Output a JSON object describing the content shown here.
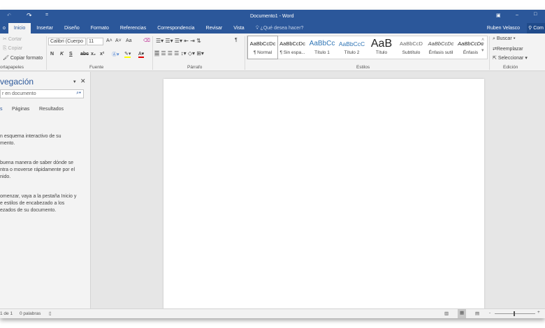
{
  "title": "Documento1 - Word",
  "quick_access": {
    "undo": "↶",
    "redo": "↷",
    "customize": "="
  },
  "window_controls": {
    "ribbon_options": "▣",
    "minimize": "–",
    "maximize": "□"
  },
  "tabs": [
    "Inicio",
    "Insertar",
    "Diseño",
    "Formato",
    "Referencias",
    "Correspondencia",
    "Revisar",
    "Vista"
  ],
  "tell_me": "¿Qué desea hacer?",
  "user": "Ruben Velasco",
  "share": "Com",
  "clipboard": {
    "cut": "Cortar",
    "copy": "Copiar",
    "format_painter": "Copiar formato",
    "label": "ortapapeles"
  },
  "font": {
    "name": "Calibri (Cuerpo",
    "size": "11",
    "label": "Fuente",
    "bold": "N",
    "italic": "K",
    "underline": "S",
    "strike": "abc",
    "sub": "x₂",
    "sup": "x²",
    "grow": "A˄",
    "shrink": "A˅",
    "case": "Aa"
  },
  "paragraph": {
    "label": "Párrafo",
    "show_marks": "¶"
  },
  "styles": {
    "label": "Estilos",
    "items": [
      {
        "preview": "AaBbCcDc",
        "name": "¶ Normal"
      },
      {
        "preview": "AaBbCcDc",
        "name": "¶ Sin espa..."
      },
      {
        "preview": "AaBbCc",
        "name": "Título 1"
      },
      {
        "preview": "AaBbCcC",
        "name": "Título 2"
      },
      {
        "preview": "AaB",
        "name": "Título"
      },
      {
        "preview": "AaBbCcD",
        "name": "Subtítulo"
      },
      {
        "preview": "AaBbCcDc",
        "name": "Énfasis sutil"
      },
      {
        "preview": "AaBbCcDc",
        "name": "Énfasis"
      }
    ]
  },
  "editing": {
    "find": "Buscar",
    "replace": "Reemplazar",
    "select": "Seleccionar",
    "label": "Edición"
  },
  "navigation": {
    "title": "vegación",
    "search_placeholder": "r en documento",
    "tabs": [
      "s",
      "Páginas",
      "Resultados"
    ],
    "paragraphs": [
      "n esquema interactivo de su\nmento.",
      "buena manera de saber dónde se\nntra o moverse rápidamente por el\nnido.",
      "omenzar, vaya a la pestaña Inicio y\ne estilos de encabezado a los\nezados de su documento."
    ]
  },
  "status": {
    "page": "1 de 1",
    "words": "0 palabras"
  },
  "colors": {
    "brand": "#2b579a",
    "highlight": "#ffff00",
    "font_color": "#e00000"
  }
}
